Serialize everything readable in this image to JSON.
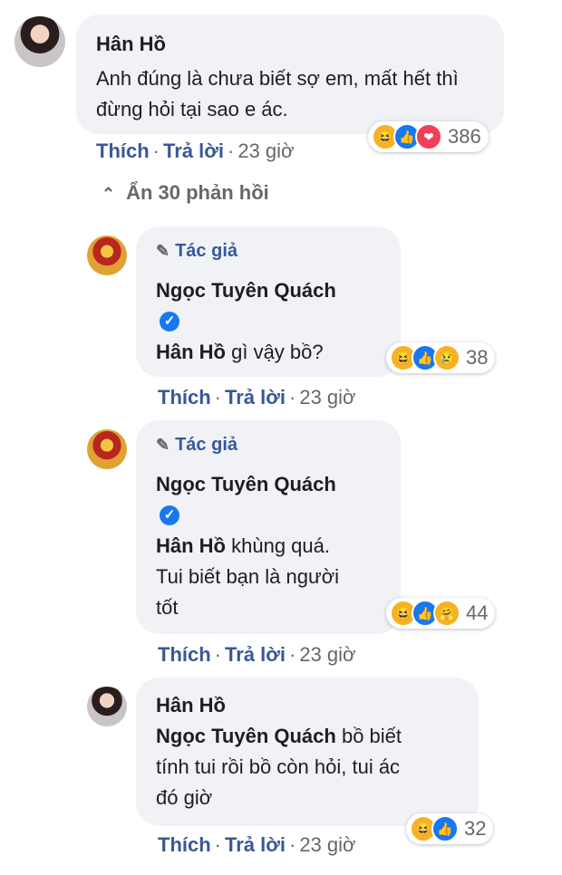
{
  "comment": {
    "author": "Hân Hồ",
    "text": "Anh đúng là chưa biết sợ em, mất hết thì đừng hỏi tại sao e ác.",
    "reactions": [
      "haha-icon",
      "like-icon",
      "love-icon"
    ],
    "reaction_count": "386",
    "like_label": "Thích",
    "reply_label": "Trả lời",
    "time": "23 giờ"
  },
  "hide_replies_label": "Ẩn 30 phản hồi",
  "replies": [
    {
      "badge": "Tác giả",
      "author": "Ngọc Tuyên Quách",
      "mention": "Hân Hồ",
      "text": " gì vậy bồ?",
      "reaction_count": "38",
      "like_label": "Thích",
      "reply_label": "Trả lời",
      "time": "23 giờ"
    },
    {
      "badge": "Tác giả",
      "author": "Ngọc Tuyên Quách",
      "mention": "Hân Hồ",
      "text": " khùng quá.",
      "text2": "Tui biết bạn là người",
      "text3": "tốt",
      "reaction_count": "44",
      "like_label": "Thích",
      "reply_label": "Trả lời",
      "time": "23 giờ"
    },
    {
      "author": "Hân Hồ",
      "mention": "Ngọc Tuyên Quách",
      "text": " bồ biết",
      "text2": "tính tui rồi bồ còn hỏi, tui ác",
      "text3": "đó giờ",
      "reaction_count": "32",
      "like_label": "Thích",
      "reply_label": "Trả lời",
      "time": "23 giờ"
    }
  ],
  "colors": {
    "bubble": "#f0f2f5",
    "link": "#385898",
    "meta": "#65676b",
    "verified": "#1877f2"
  }
}
